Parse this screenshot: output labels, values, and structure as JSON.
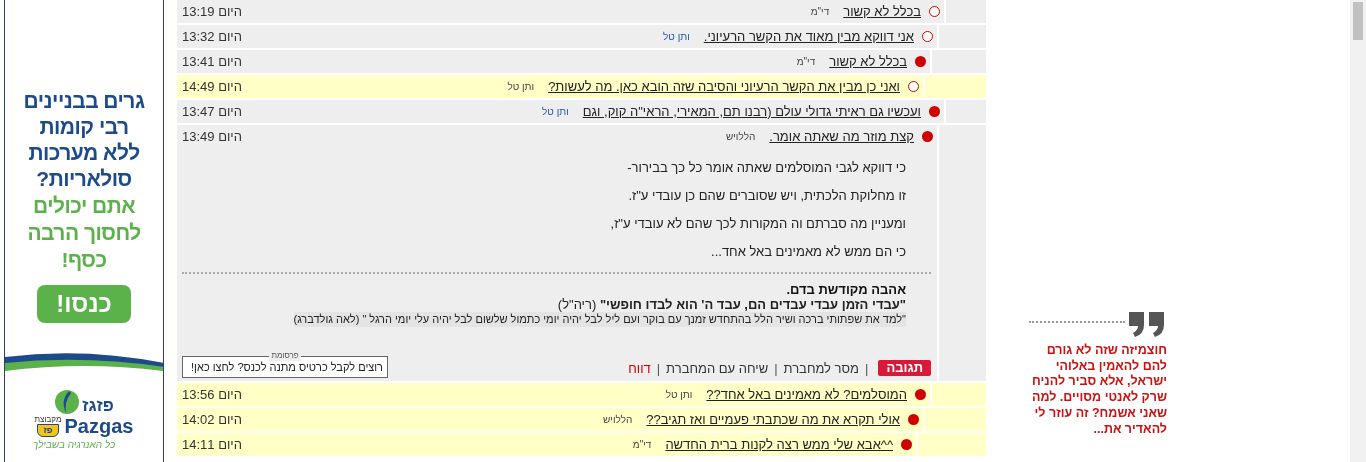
{
  "ad_banner": {
    "headline": [
      "גרים בבניינים",
      "רבי קומות",
      "ללא מערכות",
      "סולאריות?"
    ],
    "subline": [
      "אתם יכולים",
      "לחסוך הרבה",
      "כסף!"
    ],
    "button": "כנסו!",
    "brand_hebrew": "פזגז",
    "brand_latin": "Pazgas",
    "group_label": "מקבוצת",
    "group_badge": "פז",
    "slogan": "כל האנרגיה בשבילך"
  },
  "thread": [
    {
      "title": "בכלל לא קשור",
      "author": {
        "name": "די\"מ",
        "linked": false
      },
      "time": "היום 13:19",
      "new": false,
      "highlighted": false,
      "children": [
        {
          "title": "אני דווקא מבין מאוד את הקשר הרעיוני.",
          "author": {
            "name": "ותן טל",
            "linked": true
          },
          "time": "היום 13:32",
          "new": false,
          "highlighted": false,
          "children": [
            {
              "title": "בכלל לא קשור",
              "author": {
                "name": "די\"מ",
                "linked": false
              },
              "time": "היום 13:41",
              "new": true,
              "highlighted": false,
              "children": [
                {
                  "title": "ואני כן מבין את הקשר הרעיוני והסיבה שזה הובא כאן. מה לעשות?",
                  "author": {
                    "name": "ותן טל",
                    "linked": false
                  },
                  "time": "היום 14:49",
                  "new": false,
                  "highlighted": true
                }
              ]
            }
          ]
        }
      ]
    },
    {
      "title": "ועכשיו גם ראיתי גדולי עולם (רבנו תם, המאירי, הראי\"ה קוק, וגם",
      "author": {
        "name": "ותן טל",
        "linked": true
      },
      "time": "היום 13:47",
      "new": true,
      "highlighted": false,
      "children": [
        {
          "title": "קצת מוזר מה שאתה אומר.",
          "author": {
            "name": "הללויש",
            "linked": false
          },
          "time": "היום 13:49",
          "new": true,
          "highlighted": false,
          "body": {
            "paragraphs": [
              "כי דווקא לגבי המוסלמים שאתה אומר כל כך בבירור-",
              "זו מחלוקת הלכתית, ויש שסוברים שהם כן עובדי ע\"ז.",
              "ומעניין מה סברתם וה המקורות לכך שהם לא עובדי ע\"ז,",
              "כי הם ממש לא מאמינים באל אחד..."
            ],
            "signature": [
              {
                "kind": "bold",
                "text": "אהבה מקודשת בדם."
              },
              {
                "kind": "plain",
                "text": "**\"עבדי הזמן עבדי עבדים הם, עבד ה' הוא לבדו חופשי\"** (ריה\"ל)"
              },
              {
                "kind": "highlighted",
                "text": "\"למד את שפתותי ברכה ושיר הלל בהתחדש זמנך עם בוקר ועם ליל לבל יהיה יומי כתמול שלשום לבל יהיה עלי יומי הרגל \" (לאה גולדברג)"
              }
            ],
            "ad": {
              "legend": "פרסומת",
              "text": "רוצים לקבל כרטיס מתנה לכנס? לחצו כאן!"
            },
            "actions": [
              {
                "kind": "button",
                "label": "תגובה"
              },
              {
                "kind": "separator",
                "label": "|"
              },
              {
                "kind": "link",
                "label": "מסר למחברת"
              },
              {
                "kind": "separator",
                "label": "|"
              },
              {
                "kind": "link",
                "label": "שיחה עם המחברת"
              },
              {
                "kind": "separator",
                "label": "|"
              },
              {
                "kind": "report",
                "label": "דווח"
              }
            ]
          },
          "children": [
            {
              "title": "המוסלמים? לא מאמינים באל אחד??",
              "author": {
                "name": "ותן טל",
                "linked": false
              },
              "time": "היום 13:56",
              "new": true,
              "highlighted": true,
              "children": [
                {
                  "title": "אולי תקרא את מה שכתבתי פעמיים ואז תגיב??",
                  "author": {
                    "name": "הללויש",
                    "linked": false
                  },
                  "time": "היום 14:02",
                  "new": true,
                  "highlighted": true,
                  "children": [
                    {
                      "title": "^^אבא שלי ממש רצה לקנות ברית החדשה",
                      "author": {
                        "name": "די\"מ",
                        "linked": false
                      },
                      "time": "היום 14:11",
                      "new": true,
                      "highlighted": true
                    }
                  ]
                }
              ]
            }
          ]
        }
      ]
    }
  ],
  "pull_quote": {
    "text": "חוצמיזה שזה לא גורם להם להאמין באלוהי ישראל, אלא סביר להניח שרק לאנטי מסויים. למה שאני אשמח? זה עוזר לי להאדיר את..."
  }
}
